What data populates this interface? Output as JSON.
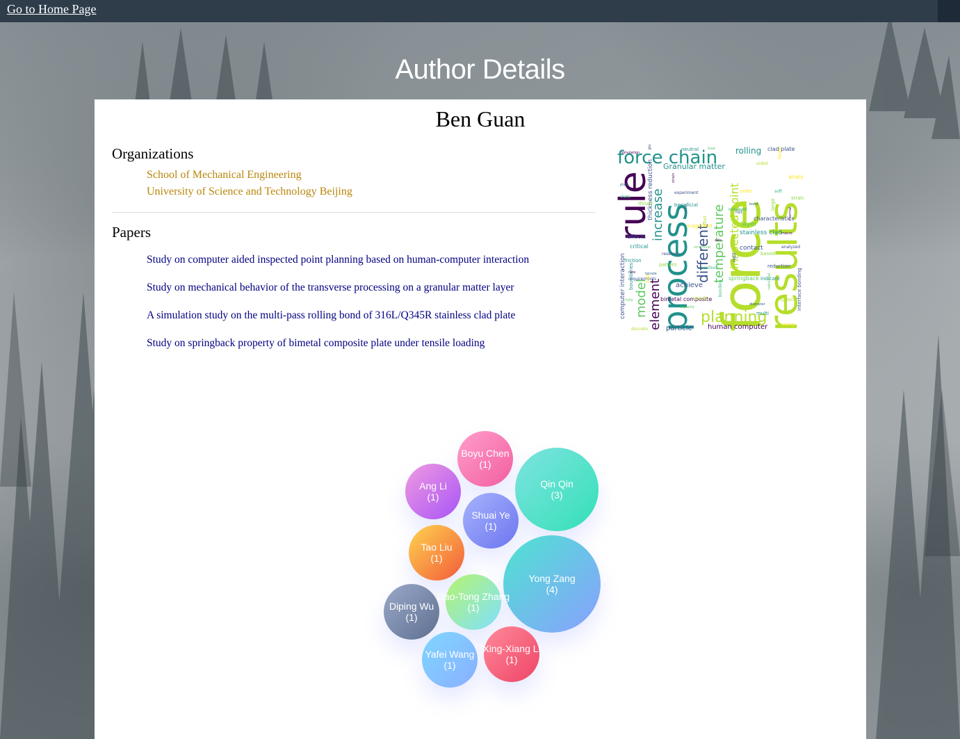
{
  "nav": {
    "home_link": "Go to Home Page"
  },
  "page": {
    "heading": "Author Details"
  },
  "author": {
    "name": "Ben Guan",
    "organizations_title": "Organizations",
    "organizations": [
      "School of Mechanical Engineering",
      "University of Science and Technology Beijing"
    ],
    "papers_title": "Papers",
    "papers": [
      "Study on computer aided inspected point planning based on human-computer interaction",
      "Study on mechanical behavior of the transverse processing on a granular matter layer",
      "A simulation study on the multi-pass rolling bond of 316L/Q345R stainless clad plate",
      "Study on springback property of bimetal composite plate under tensile loading"
    ]
  },
  "wordcloud": {
    "words": [
      "force",
      "results",
      "process",
      "rule",
      "force chain",
      "planning",
      "element",
      "model",
      "increase",
      "different",
      "temperature",
      "inspected point",
      "Granular matter",
      "rolling",
      "clad plate",
      "bimetal composite",
      "human computer",
      "particle",
      "achieve",
      "stainless clad",
      "contact",
      "springback",
      "computer interaction",
      "layer",
      "reduction",
      "analysis",
      "thickness reduction",
      "characteristics",
      "interface bonding",
      "critical",
      "effects",
      "friction",
      "research",
      "simulation",
      "pushing",
      "neutral",
      "load",
      "aided",
      "finite",
      "plate",
      "state",
      "thrust",
      "strain",
      "experiment",
      "beneficial",
      "structural",
      "offset",
      "order",
      "bond",
      "soft",
      "large",
      "macro",
      "analyzed",
      "indicate",
      "individual",
      "system",
      "using",
      "diameter",
      "bonding",
      "pattern",
      "rate",
      "requirements",
      "boundaries",
      "fully",
      "discrete",
      "suggested",
      "show",
      "obtained",
      "based",
      "axis",
      "rigid",
      "multi",
      "capacity",
      "gravity",
      "fast",
      "tensile",
      "position",
      "strategy",
      "thermal",
      "hot",
      "cold"
    ],
    "colors": [
      "#440154",
      "#3b528b",
      "#21918c",
      "#5ec962",
      "#b5de2b",
      "#fde725",
      "#31688e",
      "#35b779",
      "#90d743"
    ]
  },
  "coauthors": [
    {
      "name": "Boyu Chen",
      "count": "(1)",
      "c1": "#ff9ecb",
      "c2": "#f25fa0"
    },
    {
      "name": "Qin Qin",
      "count": "(3)",
      "c1": "#7fe3e0",
      "c2": "#33e0b8"
    },
    {
      "name": "Ang Li",
      "count": "(1)",
      "c1": "#f09ae0",
      "c2": "#a855f7"
    },
    {
      "name": "Shuai Ye",
      "count": "(1)",
      "c1": "#a5b4fc",
      "c2": "#6d75f0"
    },
    {
      "name": "Tao Liu",
      "count": "(1)",
      "c1": "#ffd54f",
      "c2": "#f25a3a"
    },
    {
      "name": "Yong Zang",
      "count": "(4)",
      "c1": "#4ee3d0",
      "c2": "#8aa0ff"
    },
    {
      "name": "Dao-Tong Zhang",
      "count": "(1)",
      "c1": "#b6f46e",
      "c2": "#7fe0ff"
    },
    {
      "name": "Diping Wu",
      "count": "(1)",
      "c1": "#9aa9c9",
      "c2": "#5f6f8f"
    },
    {
      "name": "Yafei Wang",
      "count": "(1)",
      "c1": "#7fd6ff",
      "c2": "#8ab0ff"
    },
    {
      "name": "Xing-Xiang Li",
      "count": "(1)",
      "c1": "#ff8a9a",
      "c2": "#ee4466"
    }
  ]
}
